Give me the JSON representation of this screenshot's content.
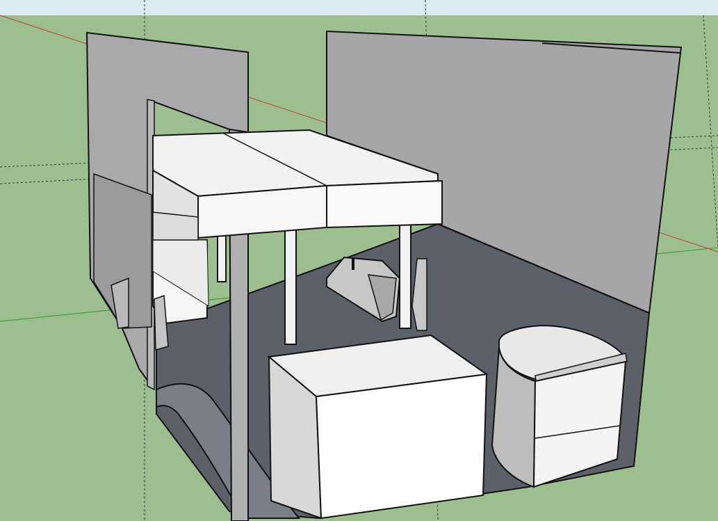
{
  "app": {
    "name": ""
  },
  "viewport": {
    "background": {
      "sky": "#d8e9f2",
      "ground": "#9dbf8f"
    },
    "axes": {
      "red": "#c0392b",
      "green": "#2e9a2e"
    }
  },
  "model": {
    "objects": [
      {
        "name": "left-wall-panel",
        "color": "#a9a9ab"
      },
      {
        "name": "back-wall-panel",
        "color": "#a9a9ab"
      },
      {
        "name": "floor",
        "color": "#5b6068"
      },
      {
        "name": "loft-bed-platform",
        "color": "#f2f2f2"
      },
      {
        "name": "storage-cabinet",
        "color": "#f2f2f2"
      },
      {
        "name": "toilet-unit",
        "color": "#d9d9d9"
      },
      {
        "name": "wheel-well",
        "color": "#b3b3b3"
      }
    ]
  }
}
